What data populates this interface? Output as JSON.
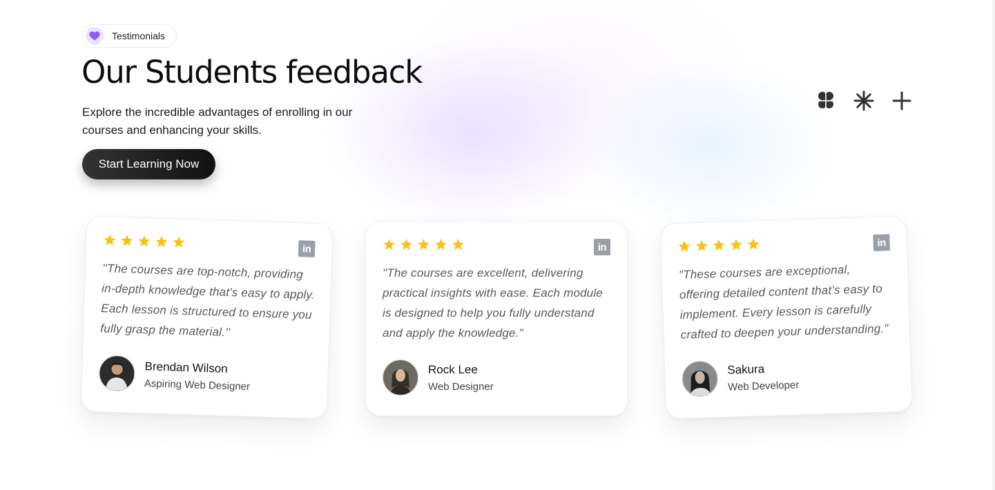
{
  "badge": {
    "label": "Testimonials",
    "icon": "heart-icon",
    "icon_color": "#8b5cf6"
  },
  "heading": "Our Students feedback",
  "subtitle": "Explore the incredible advantages of enrolling in our courses and enhancing your skills.",
  "cta_label": "Start Learning Now",
  "decorations": [
    "clover-icon",
    "asterisk-icon",
    "plus-icon"
  ],
  "accent_colors": {
    "star": "#f6c315",
    "linkedin": "#9aa0a8"
  },
  "testimonials": [
    {
      "rating": 5,
      "quote": "''The courses are top-notch, providing in-depth knowledge that's easy to apply. Each lesson is structured to ensure you fully grasp the material.''",
      "name": "Brendan Wilson",
      "role": "Aspiring Web Designer",
      "social_icon": "linkedin-icon",
      "social_label": "in"
    },
    {
      "rating": 5,
      "quote": "\"The courses are excellent, delivering practical insights with ease. Each module is designed to help you fully understand and apply the knowledge.\"",
      "name": "Rock Lee",
      "role": "Web Designer",
      "social_icon": "linkedin-icon",
      "social_label": "in"
    },
    {
      "rating": 5,
      "quote": "\"These courses are exceptional, offering detailed content that’s easy to implement. Every lesson is carefully crafted to deepen your understanding.\"",
      "name": "Sakura",
      "role": "Web Developer",
      "social_icon": "linkedin-icon",
      "social_label": "in"
    }
  ]
}
